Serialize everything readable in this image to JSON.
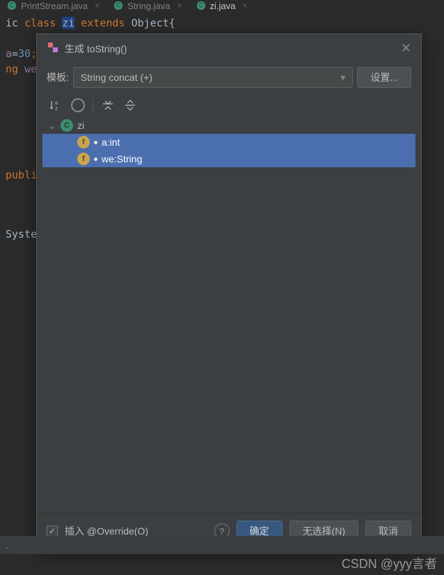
{
  "tabs": [
    {
      "label": "PrintStream.java",
      "icon": "java-class-icon"
    },
    {
      "label": "String.java",
      "icon": "java-class-icon"
    },
    {
      "label": "zi.java",
      "icon": "java-class-icon",
      "active": true
    }
  ],
  "code": {
    "line1_pre": "ic ",
    "line1_kw1": "class",
    "line1_name": "zi",
    "line1_kw2": "extends",
    "line1_obj": "Object{",
    "line3_var": "a",
    "line3_eq": "=",
    "line3_val": "30",
    "line3_semi": ";",
    "line4_kw": "ng",
    "line4_var": "we",
    "line6_kw": "publi",
    "line8_id": "Syste",
    "status": "."
  },
  "dialog": {
    "title": "生成 toString()",
    "template_label": "模板:",
    "template_value": "String concat (+)",
    "settings_btn": "设置...",
    "tree": {
      "root": {
        "name": "zi",
        "badge": "C"
      },
      "fields": [
        {
          "name": "a:int",
          "badge": "f"
        },
        {
          "name": "we:String",
          "badge": "f"
        }
      ]
    },
    "override_label": "插入 @Override(O)",
    "ok_btn": "确定",
    "deselect_btn": "无选择(N)",
    "cancel_btn": "取消"
  },
  "watermark": "CSDN @yyy言者"
}
